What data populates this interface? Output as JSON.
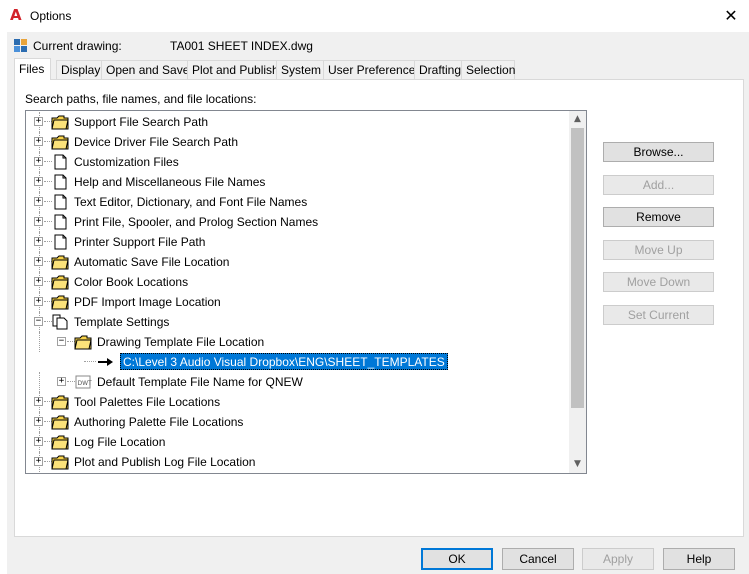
{
  "window": {
    "title": "Options",
    "app_icon_glyph": "A",
    "close_glyph": "✕"
  },
  "current_drawing": {
    "label": "Current drawing:",
    "name": "TA001 SHEET INDEX.dwg"
  },
  "tabs": [
    {
      "label": "Files",
      "active": true
    },
    {
      "label": "Display"
    },
    {
      "label": "Open and Save"
    },
    {
      "label": "Plot and Publish"
    },
    {
      "label": "System"
    },
    {
      "label": "User Preferences"
    },
    {
      "label": "Drafting"
    },
    {
      "label": "Selection"
    }
  ],
  "files_panel": {
    "label": "Search paths, file names, and file locations:"
  },
  "tree": {
    "items": [
      {
        "label": "Support File Search Path",
        "icon": "folder-icon"
      },
      {
        "label": "Device Driver File Search Path",
        "icon": "folder-icon"
      },
      {
        "label": "Customization Files",
        "icon": "document-icon"
      },
      {
        "label": "Help and Miscellaneous File Names",
        "icon": "document-icon"
      },
      {
        "label": "Text Editor, Dictionary, and Font File Names",
        "icon": "document-icon"
      },
      {
        "label": "Print File, Spooler, and Prolog Section Names",
        "icon": "document-icon"
      },
      {
        "label": "Printer Support File Path",
        "icon": "document-icon"
      },
      {
        "label": "Automatic Save File Location",
        "icon": "folder-icon"
      },
      {
        "label": "Color Book Locations",
        "icon": "folder-icon"
      },
      {
        "label": "PDF Import Image Location",
        "icon": "folder-icon"
      },
      {
        "label": "Template Settings",
        "icon": "documents-icon"
      },
      {
        "label": "Drawing Template File Location",
        "icon": "folder-icon"
      },
      {
        "label": "C:\\Level 3 Audio Visual Dropbox\\ENG\\SHEET_TEMPLATES",
        "icon": "arrow-icon"
      },
      {
        "label": "Default Template File Name for QNEW",
        "icon": "dwt-file-icon"
      },
      {
        "label": "Tool Palettes File Locations",
        "icon": "folder-icon"
      },
      {
        "label": "Authoring Palette File Locations",
        "icon": "folder-icon"
      },
      {
        "label": "Log File Location",
        "icon": "folder-icon"
      },
      {
        "label": "Plot and Publish Log File Location",
        "icon": "folder-icon"
      }
    ],
    "expander_plus": "+",
    "expander_minus": "−"
  },
  "side_buttons": {
    "browse": "Browse...",
    "add": "Add...",
    "remove": "Remove",
    "move_up": "Move Up",
    "move_down": "Move Down",
    "set_current": "Set Current"
  },
  "bottom_buttons": {
    "ok": "OK",
    "cancel": "Cancel",
    "apply": "Apply",
    "help": "Help"
  },
  "colors": {
    "selection": "#0078d7",
    "folder_yellow": "#f8d34a",
    "app_red": "#d2232a"
  }
}
